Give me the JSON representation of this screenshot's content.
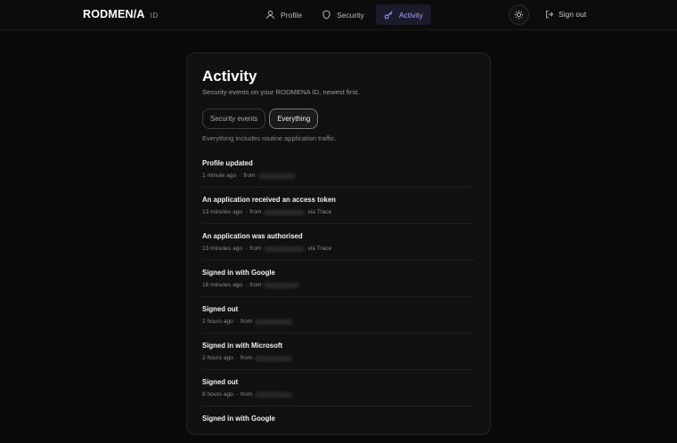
{
  "brand": {
    "name": "RODMEN/A",
    "suffix": "ID"
  },
  "nav": {
    "items": [
      {
        "label": "Profile",
        "icon": "user-icon",
        "active": false
      },
      {
        "label": "Security",
        "icon": "shield-icon",
        "active": false
      },
      {
        "label": "Activity",
        "icon": "key-icon",
        "active": true
      }
    ]
  },
  "header": {
    "theme_icon": "sun-icon",
    "signout_label": "Sign out"
  },
  "page": {
    "title": "Activity",
    "subtitle": "Security events on your RODMENA ID, newest first.",
    "filters": [
      {
        "label": "Security events",
        "active": false
      },
      {
        "label": "Everything",
        "active": true
      }
    ],
    "hint": "Everything includes routine application traffic."
  },
  "events": [
    {
      "title": "Profile updated",
      "time": "1 minute ago",
      "from": "from",
      "via": ""
    },
    {
      "title": "An application received an access token",
      "time": "13 minutes ago",
      "from": "from",
      "via": "via Trace"
    },
    {
      "title": "An application was authorised",
      "time": "13 minutes ago",
      "from": "from",
      "via": "via Trace"
    },
    {
      "title": "Signed in with Google",
      "time": "18 minutes ago",
      "from": "from",
      "via": ""
    },
    {
      "title": "Signed out",
      "time": "2 hours ago",
      "from": "from",
      "via": ""
    },
    {
      "title": "Signed in with Microsoft",
      "time": "2 hours ago",
      "from": "from",
      "via": ""
    },
    {
      "title": "Signed out",
      "time": "8 hours ago",
      "from": "from",
      "via": ""
    },
    {
      "title": "Signed in with Google",
      "time": "",
      "from": "",
      "via": ""
    }
  ]
}
